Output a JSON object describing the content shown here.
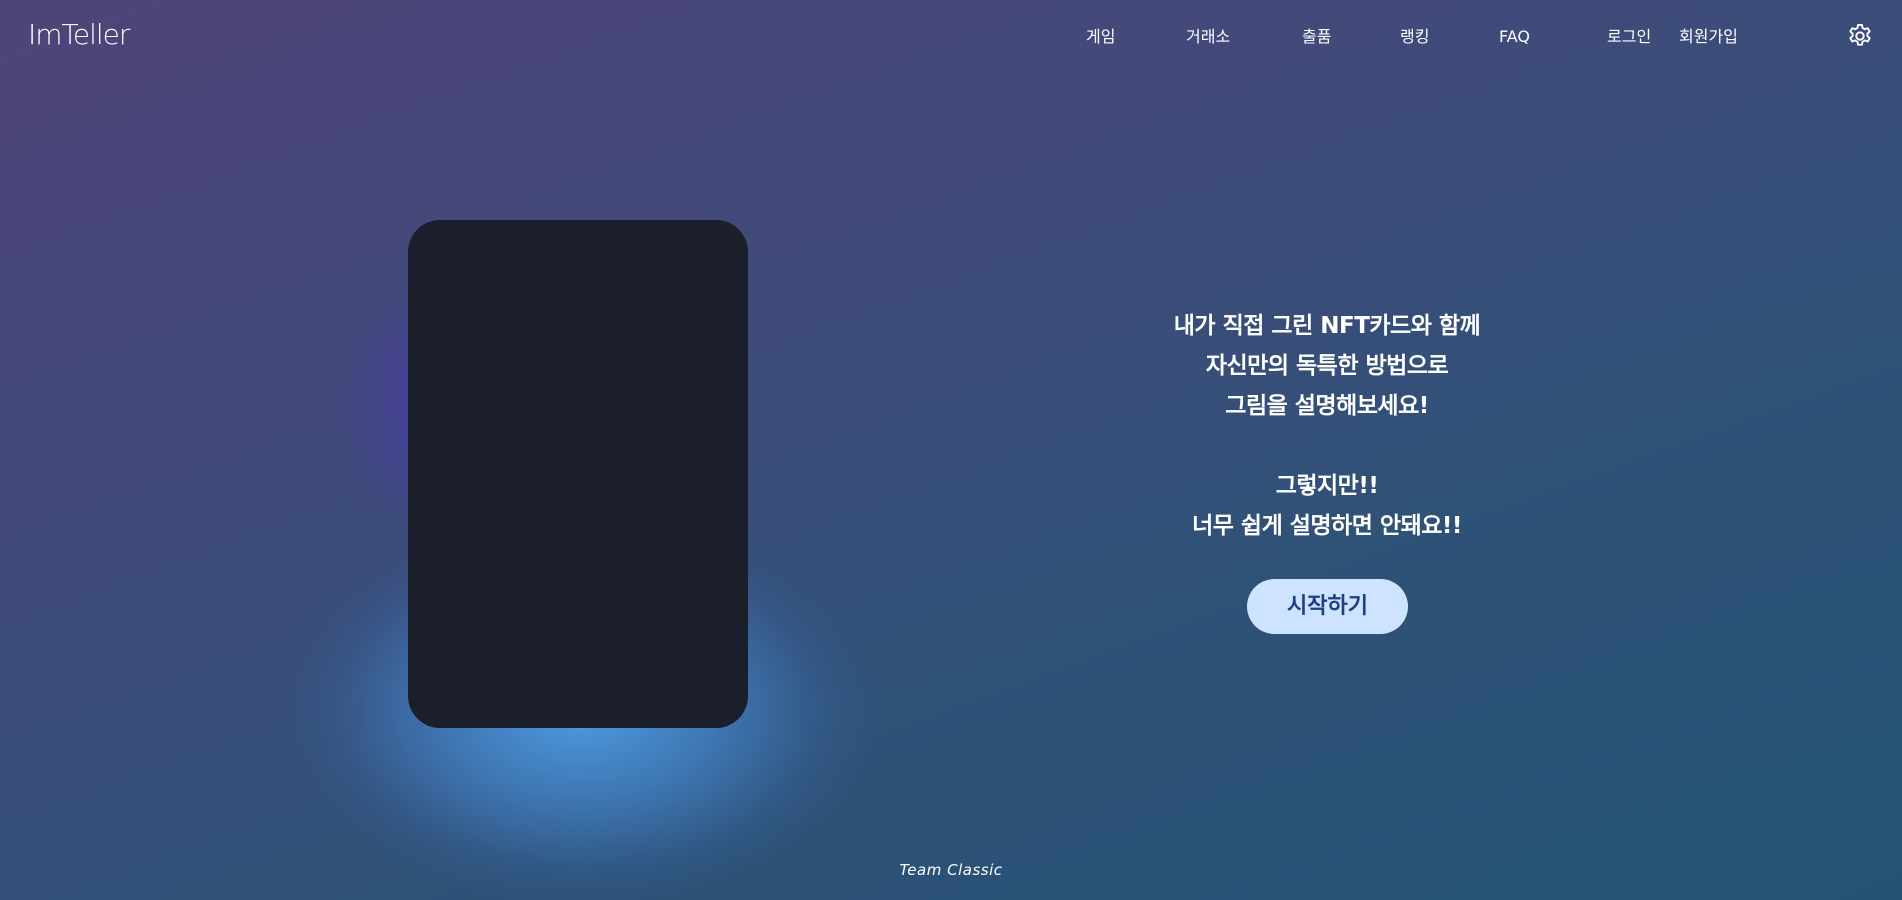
{
  "header": {
    "logo_text": "ImTeller",
    "nav": [
      {
        "label": "게임"
      },
      {
        "label": "거래소"
      },
      {
        "label": "출품"
      },
      {
        "label": "랭킹"
      },
      {
        "label": "FAQ"
      }
    ],
    "auth": {
      "login": "로그인",
      "signup": "회원가입"
    },
    "settings_icon": "gear-icon"
  },
  "hero": {
    "lines": [
      "내가 직접 그린 NFT카드와 함께",
      "자신만의 독특한 방법으로",
      "그림을 설명해보세요!",
      "그렇지만!!",
      "너무 쉽게 설명하면 안돼요!!"
    ],
    "start_button": "시작하기"
  },
  "footer": {
    "text": "Team Classic"
  },
  "colors": {
    "card": "#1b1f2b",
    "button_bg": "#cde3ff",
    "button_text": "#1f3f83",
    "glow_blue": "#50a0e6",
    "glow_purple": "#5432be"
  }
}
